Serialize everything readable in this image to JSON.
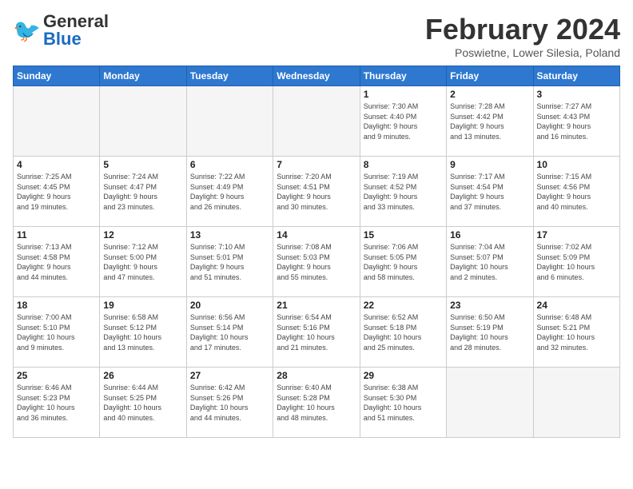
{
  "logo": {
    "text_general": "General",
    "text_blue": "Blue"
  },
  "title": "February 2024",
  "location": "Poswietne, Lower Silesia, Poland",
  "weekdays": [
    "Sunday",
    "Monday",
    "Tuesday",
    "Wednesday",
    "Thursday",
    "Friday",
    "Saturday"
  ],
  "weeks": [
    [
      {
        "day": "",
        "info": ""
      },
      {
        "day": "",
        "info": ""
      },
      {
        "day": "",
        "info": ""
      },
      {
        "day": "",
        "info": ""
      },
      {
        "day": "1",
        "info": "Sunrise: 7:30 AM\nSunset: 4:40 PM\nDaylight: 9 hours\nand 9 minutes."
      },
      {
        "day": "2",
        "info": "Sunrise: 7:28 AM\nSunset: 4:42 PM\nDaylight: 9 hours\nand 13 minutes."
      },
      {
        "day": "3",
        "info": "Sunrise: 7:27 AM\nSunset: 4:43 PM\nDaylight: 9 hours\nand 16 minutes."
      }
    ],
    [
      {
        "day": "4",
        "info": "Sunrise: 7:25 AM\nSunset: 4:45 PM\nDaylight: 9 hours\nand 19 minutes."
      },
      {
        "day": "5",
        "info": "Sunrise: 7:24 AM\nSunset: 4:47 PM\nDaylight: 9 hours\nand 23 minutes."
      },
      {
        "day": "6",
        "info": "Sunrise: 7:22 AM\nSunset: 4:49 PM\nDaylight: 9 hours\nand 26 minutes."
      },
      {
        "day": "7",
        "info": "Sunrise: 7:20 AM\nSunset: 4:51 PM\nDaylight: 9 hours\nand 30 minutes."
      },
      {
        "day": "8",
        "info": "Sunrise: 7:19 AM\nSunset: 4:52 PM\nDaylight: 9 hours\nand 33 minutes."
      },
      {
        "day": "9",
        "info": "Sunrise: 7:17 AM\nSunset: 4:54 PM\nDaylight: 9 hours\nand 37 minutes."
      },
      {
        "day": "10",
        "info": "Sunrise: 7:15 AM\nSunset: 4:56 PM\nDaylight: 9 hours\nand 40 minutes."
      }
    ],
    [
      {
        "day": "11",
        "info": "Sunrise: 7:13 AM\nSunset: 4:58 PM\nDaylight: 9 hours\nand 44 minutes."
      },
      {
        "day": "12",
        "info": "Sunrise: 7:12 AM\nSunset: 5:00 PM\nDaylight: 9 hours\nand 47 minutes."
      },
      {
        "day": "13",
        "info": "Sunrise: 7:10 AM\nSunset: 5:01 PM\nDaylight: 9 hours\nand 51 minutes."
      },
      {
        "day": "14",
        "info": "Sunrise: 7:08 AM\nSunset: 5:03 PM\nDaylight: 9 hours\nand 55 minutes."
      },
      {
        "day": "15",
        "info": "Sunrise: 7:06 AM\nSunset: 5:05 PM\nDaylight: 9 hours\nand 58 minutes."
      },
      {
        "day": "16",
        "info": "Sunrise: 7:04 AM\nSunset: 5:07 PM\nDaylight: 10 hours\nand 2 minutes."
      },
      {
        "day": "17",
        "info": "Sunrise: 7:02 AM\nSunset: 5:09 PM\nDaylight: 10 hours\nand 6 minutes."
      }
    ],
    [
      {
        "day": "18",
        "info": "Sunrise: 7:00 AM\nSunset: 5:10 PM\nDaylight: 10 hours\nand 9 minutes."
      },
      {
        "day": "19",
        "info": "Sunrise: 6:58 AM\nSunset: 5:12 PM\nDaylight: 10 hours\nand 13 minutes."
      },
      {
        "day": "20",
        "info": "Sunrise: 6:56 AM\nSunset: 5:14 PM\nDaylight: 10 hours\nand 17 minutes."
      },
      {
        "day": "21",
        "info": "Sunrise: 6:54 AM\nSunset: 5:16 PM\nDaylight: 10 hours\nand 21 minutes."
      },
      {
        "day": "22",
        "info": "Sunrise: 6:52 AM\nSunset: 5:18 PM\nDaylight: 10 hours\nand 25 minutes."
      },
      {
        "day": "23",
        "info": "Sunrise: 6:50 AM\nSunset: 5:19 PM\nDaylight: 10 hours\nand 28 minutes."
      },
      {
        "day": "24",
        "info": "Sunrise: 6:48 AM\nSunset: 5:21 PM\nDaylight: 10 hours\nand 32 minutes."
      }
    ],
    [
      {
        "day": "25",
        "info": "Sunrise: 6:46 AM\nSunset: 5:23 PM\nDaylight: 10 hours\nand 36 minutes."
      },
      {
        "day": "26",
        "info": "Sunrise: 6:44 AM\nSunset: 5:25 PM\nDaylight: 10 hours\nand 40 minutes."
      },
      {
        "day": "27",
        "info": "Sunrise: 6:42 AM\nSunset: 5:26 PM\nDaylight: 10 hours\nand 44 minutes."
      },
      {
        "day": "28",
        "info": "Sunrise: 6:40 AM\nSunset: 5:28 PM\nDaylight: 10 hours\nand 48 minutes."
      },
      {
        "day": "29",
        "info": "Sunrise: 6:38 AM\nSunset: 5:30 PM\nDaylight: 10 hours\nand 51 minutes."
      },
      {
        "day": "",
        "info": ""
      },
      {
        "day": "",
        "info": ""
      }
    ]
  ]
}
